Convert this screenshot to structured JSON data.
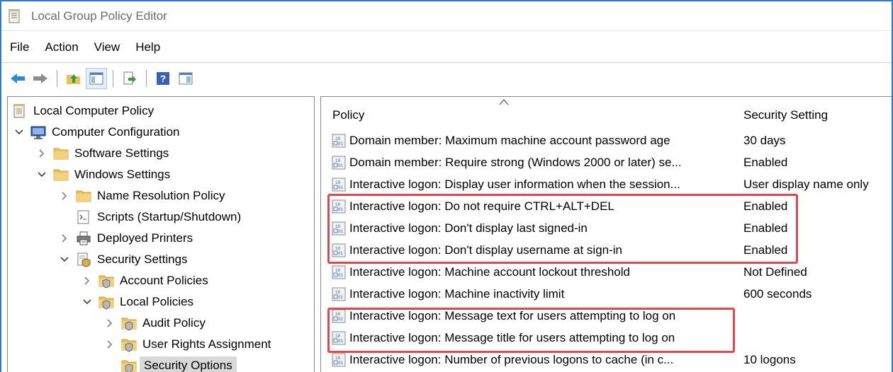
{
  "window": {
    "title": "Local Group Policy Editor"
  },
  "menu": [
    "File",
    "Action",
    "View",
    "Help"
  ],
  "toolbar": [
    "back-icon",
    "forward-icon",
    "up-folder-icon",
    "show-hide-tree-icon",
    "export-list-icon",
    "help-icon",
    "properties-icon"
  ],
  "tree": [
    {
      "label": "Local Computer Policy",
      "icon": "policy-doc-icon",
      "arrow": "none"
    },
    {
      "label": "Computer Configuration",
      "icon": "computer-icon",
      "arrow": "expanded"
    },
    {
      "label": "Software Settings",
      "icon": "folder-icon",
      "arrow": "collapsed"
    },
    {
      "label": "Windows Settings",
      "icon": "folder-icon",
      "arrow": "expanded"
    },
    {
      "label": "Name Resolution Policy",
      "icon": "folder-icon",
      "arrow": "collapsed"
    },
    {
      "label": "Scripts (Startup/Shutdown)",
      "icon": "script-icon",
      "arrow": "none"
    },
    {
      "label": "Deployed Printers",
      "icon": "printer-icon",
      "arrow": "collapsed"
    },
    {
      "label": "Security Settings",
      "icon": "security-settings-icon",
      "arrow": "expanded"
    },
    {
      "label": "Account Policies",
      "icon": "secure-folder-icon",
      "arrow": "collapsed"
    },
    {
      "label": "Local Policies",
      "icon": "secure-folder-icon",
      "arrow": "expanded"
    },
    {
      "label": "Audit Policy",
      "icon": "secure-folder-icon",
      "arrow": "collapsed"
    },
    {
      "label": "User Rights Assignment",
      "icon": "secure-folder-icon",
      "arrow": "collapsed"
    },
    {
      "label": "Security Options",
      "icon": "secure-folder-icon",
      "arrow": "none",
      "selected": true
    }
  ],
  "list": {
    "columns": {
      "policy": "Policy",
      "setting": "Security Setting"
    },
    "rows": [
      {
        "policy": "Domain member: Maximum machine account password age",
        "setting": "30 days"
      },
      {
        "policy": "Domain member: Require strong (Windows 2000 or later) se...",
        "setting": "Enabled"
      },
      {
        "policy": "Interactive logon: Display user information when the session...",
        "setting": "User display name only"
      },
      {
        "policy": "Interactive logon: Do not require CTRL+ALT+DEL",
        "setting": "Enabled"
      },
      {
        "policy": "Interactive logon: Don't display last signed-in",
        "setting": "Enabled"
      },
      {
        "policy": "Interactive logon: Don't display username at sign-in",
        "setting": "Enabled"
      },
      {
        "policy": "Interactive logon: Machine account lockout threshold",
        "setting": "Not Defined"
      },
      {
        "policy": "Interactive logon: Machine inactivity limit",
        "setting": "600 seconds"
      },
      {
        "policy": "Interactive logon: Message text for users attempting to log on",
        "setting": ""
      },
      {
        "policy": "Interactive logon: Message title for users attempting to log on",
        "setting": ""
      },
      {
        "policy": "Interactive logon: Number of previous logons to cache (in c...",
        "setting": "10 logons"
      }
    ]
  },
  "colors": {
    "highlight": "#e2474d",
    "window_border": "#2b7bd6",
    "selection": "#d9d9d9"
  }
}
